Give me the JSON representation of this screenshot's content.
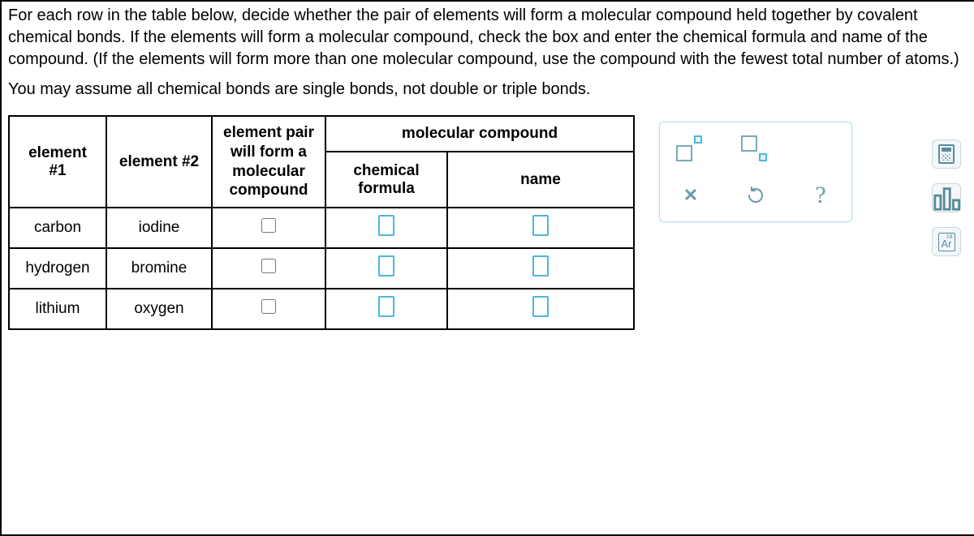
{
  "instructions": {
    "p1": "For each row in the table below, decide whether the pair of elements will form a molecular compound held together by covalent chemical bonds. If the elements will form a molecular compound, check the box and enter the chemical formula and name of the compound. (If the elements will form more than one molecular compound, use the compound with the fewest total number of atoms.)",
    "p2": "You may assume all chemical bonds are single bonds, not double or triple bonds."
  },
  "table": {
    "headers": {
      "el1": "element #1",
      "el2": "element #2",
      "pair": "element pair will form a molecular compound",
      "mol": "molecular compound",
      "formula": "chemical formula",
      "name": "name"
    },
    "rows": [
      {
        "el1": "carbon",
        "el2": "iodine"
      },
      {
        "el1": "hydrogen",
        "el2": "bromine"
      },
      {
        "el1": "lithium",
        "el2": "oxygen"
      }
    ]
  },
  "tools": {
    "close": "✕",
    "help": "?",
    "ar_sup": "18",
    "ar": "Ar"
  }
}
